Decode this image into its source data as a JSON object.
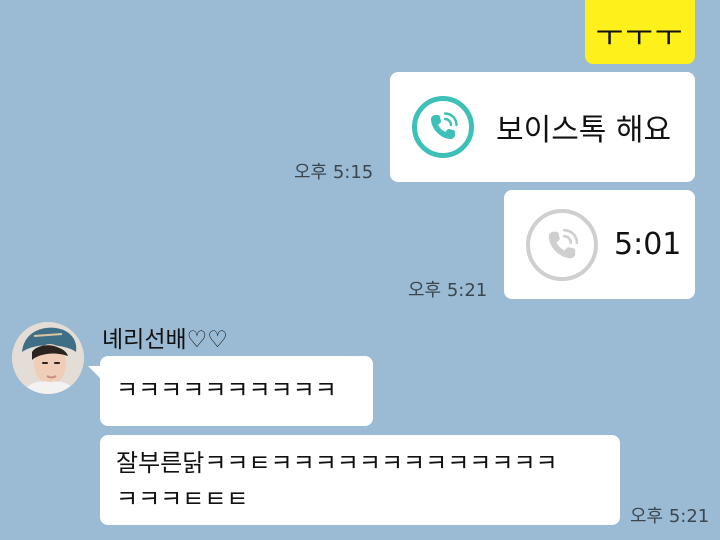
{
  "colors": {
    "background": "#9bbbd4",
    "sent_bubble": "#fef01b",
    "received_bubble": "#ffffff",
    "call_active": "#3cc0b7",
    "call_ended": "#cfcfcf"
  },
  "messages": {
    "sent_1": {
      "text": "ㅜㅜㅜ"
    },
    "sent_voice_call": {
      "text": "보이스톡 해요",
      "time": "오후 5:15",
      "icon": "phone-call-icon"
    },
    "sent_call_ended": {
      "text": "5:01",
      "time": "오후 5:21",
      "icon": "phone-call-icon"
    },
    "received": {
      "sender": "녜리선배♡♡",
      "avatar": "avatar-photo",
      "msg_1": "ㅋㅋㅋㅋㅋㅋㅋㅋㅋㅋ",
      "msg_2_line_1": "잘부른닭ㅋㅋㅌㅋㅋㅋㅋㅋㅋㅋㅋㅋㅋㅋㅋㅋ",
      "msg_2_line_2": "ㅋㅋㅋㅌㅌㅌ",
      "time": "오후 5:21"
    }
  }
}
